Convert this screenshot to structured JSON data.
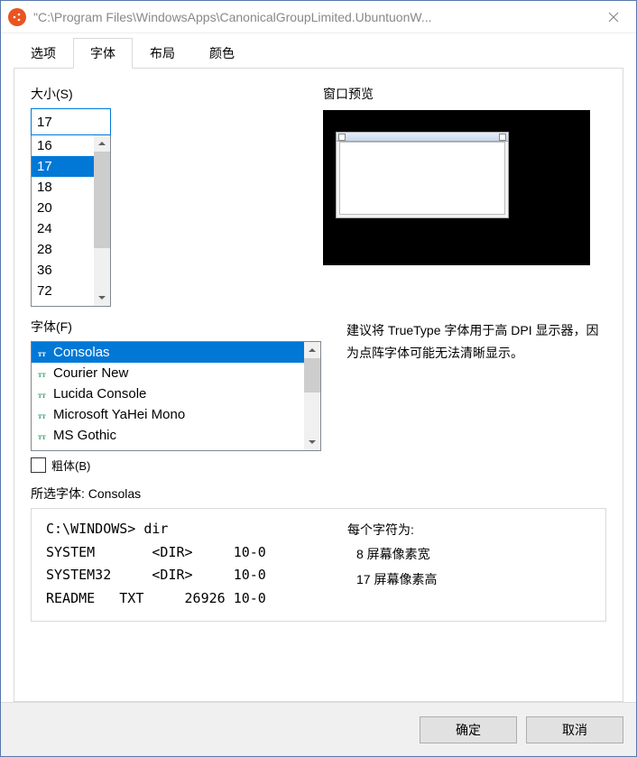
{
  "window": {
    "title": "\"C:\\Program Files\\WindowsApps\\CanonicalGroupLimited.UbuntuonW..."
  },
  "tabs": [
    {
      "label": "选项",
      "active": false
    },
    {
      "label": "字体",
      "active": true
    },
    {
      "label": "布局",
      "active": false
    },
    {
      "label": "颜色",
      "active": false
    }
  ],
  "size": {
    "label": "大小(S)",
    "value": "17",
    "options": [
      "16",
      "17",
      "18",
      "20",
      "24",
      "28",
      "36",
      "72"
    ],
    "selected": "17"
  },
  "preview": {
    "label": "窗口预览"
  },
  "font": {
    "label": "字体(F)",
    "hint": "建议将 TrueType 字体用于高 DPI 显示器，因为点阵字体可能无法清晰显示。",
    "options": [
      "Consolas",
      "Courier New",
      "Lucida Console",
      "Microsoft YaHei Mono",
      "MS Gothic"
    ],
    "selected": "Consolas",
    "bold_label": "粗体(B)",
    "bold_checked": false
  },
  "sample": {
    "label": "所选字体: Consolas",
    "lines": [
      "C:\\WINDOWS> dir",
      "SYSTEM       <DIR>     10-0",
      "SYSTEM32     <DIR>     10-0",
      "README   TXT     26926 10-0"
    ],
    "char_title": "每个字符为:",
    "char_width": "  8 屏幕像素宽",
    "char_height": "17 屏幕像素高"
  },
  "buttons": {
    "ok": "确定",
    "cancel": "取消"
  }
}
